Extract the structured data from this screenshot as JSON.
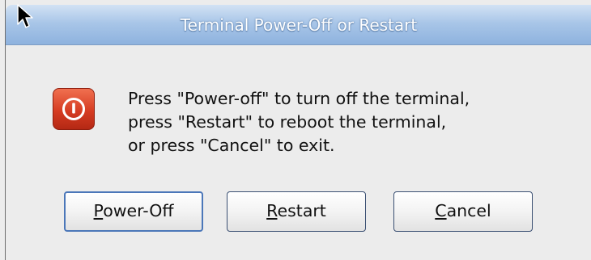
{
  "window": {
    "title": "Terminal Power-Off or Restart"
  },
  "message": {
    "lines": [
      "Press \"Power-off\" to turn off the terminal,",
      "press \"Restart\" to reboot the terminal,",
      "or press \"Cancel\" to exit."
    ]
  },
  "buttons": {
    "power_off": {
      "mnemonic": "P",
      "rest": "ower-Off"
    },
    "restart": {
      "mnemonic": "R",
      "rest": "estart"
    },
    "cancel": {
      "mnemonic": "C",
      "rest": "ancel"
    }
  },
  "icon": {
    "name": "power-icon",
    "color": "#d63c22"
  },
  "colors": {
    "titlebar": "#a9c6e8",
    "background": "#ececec",
    "button_border": "#4b77b9"
  }
}
